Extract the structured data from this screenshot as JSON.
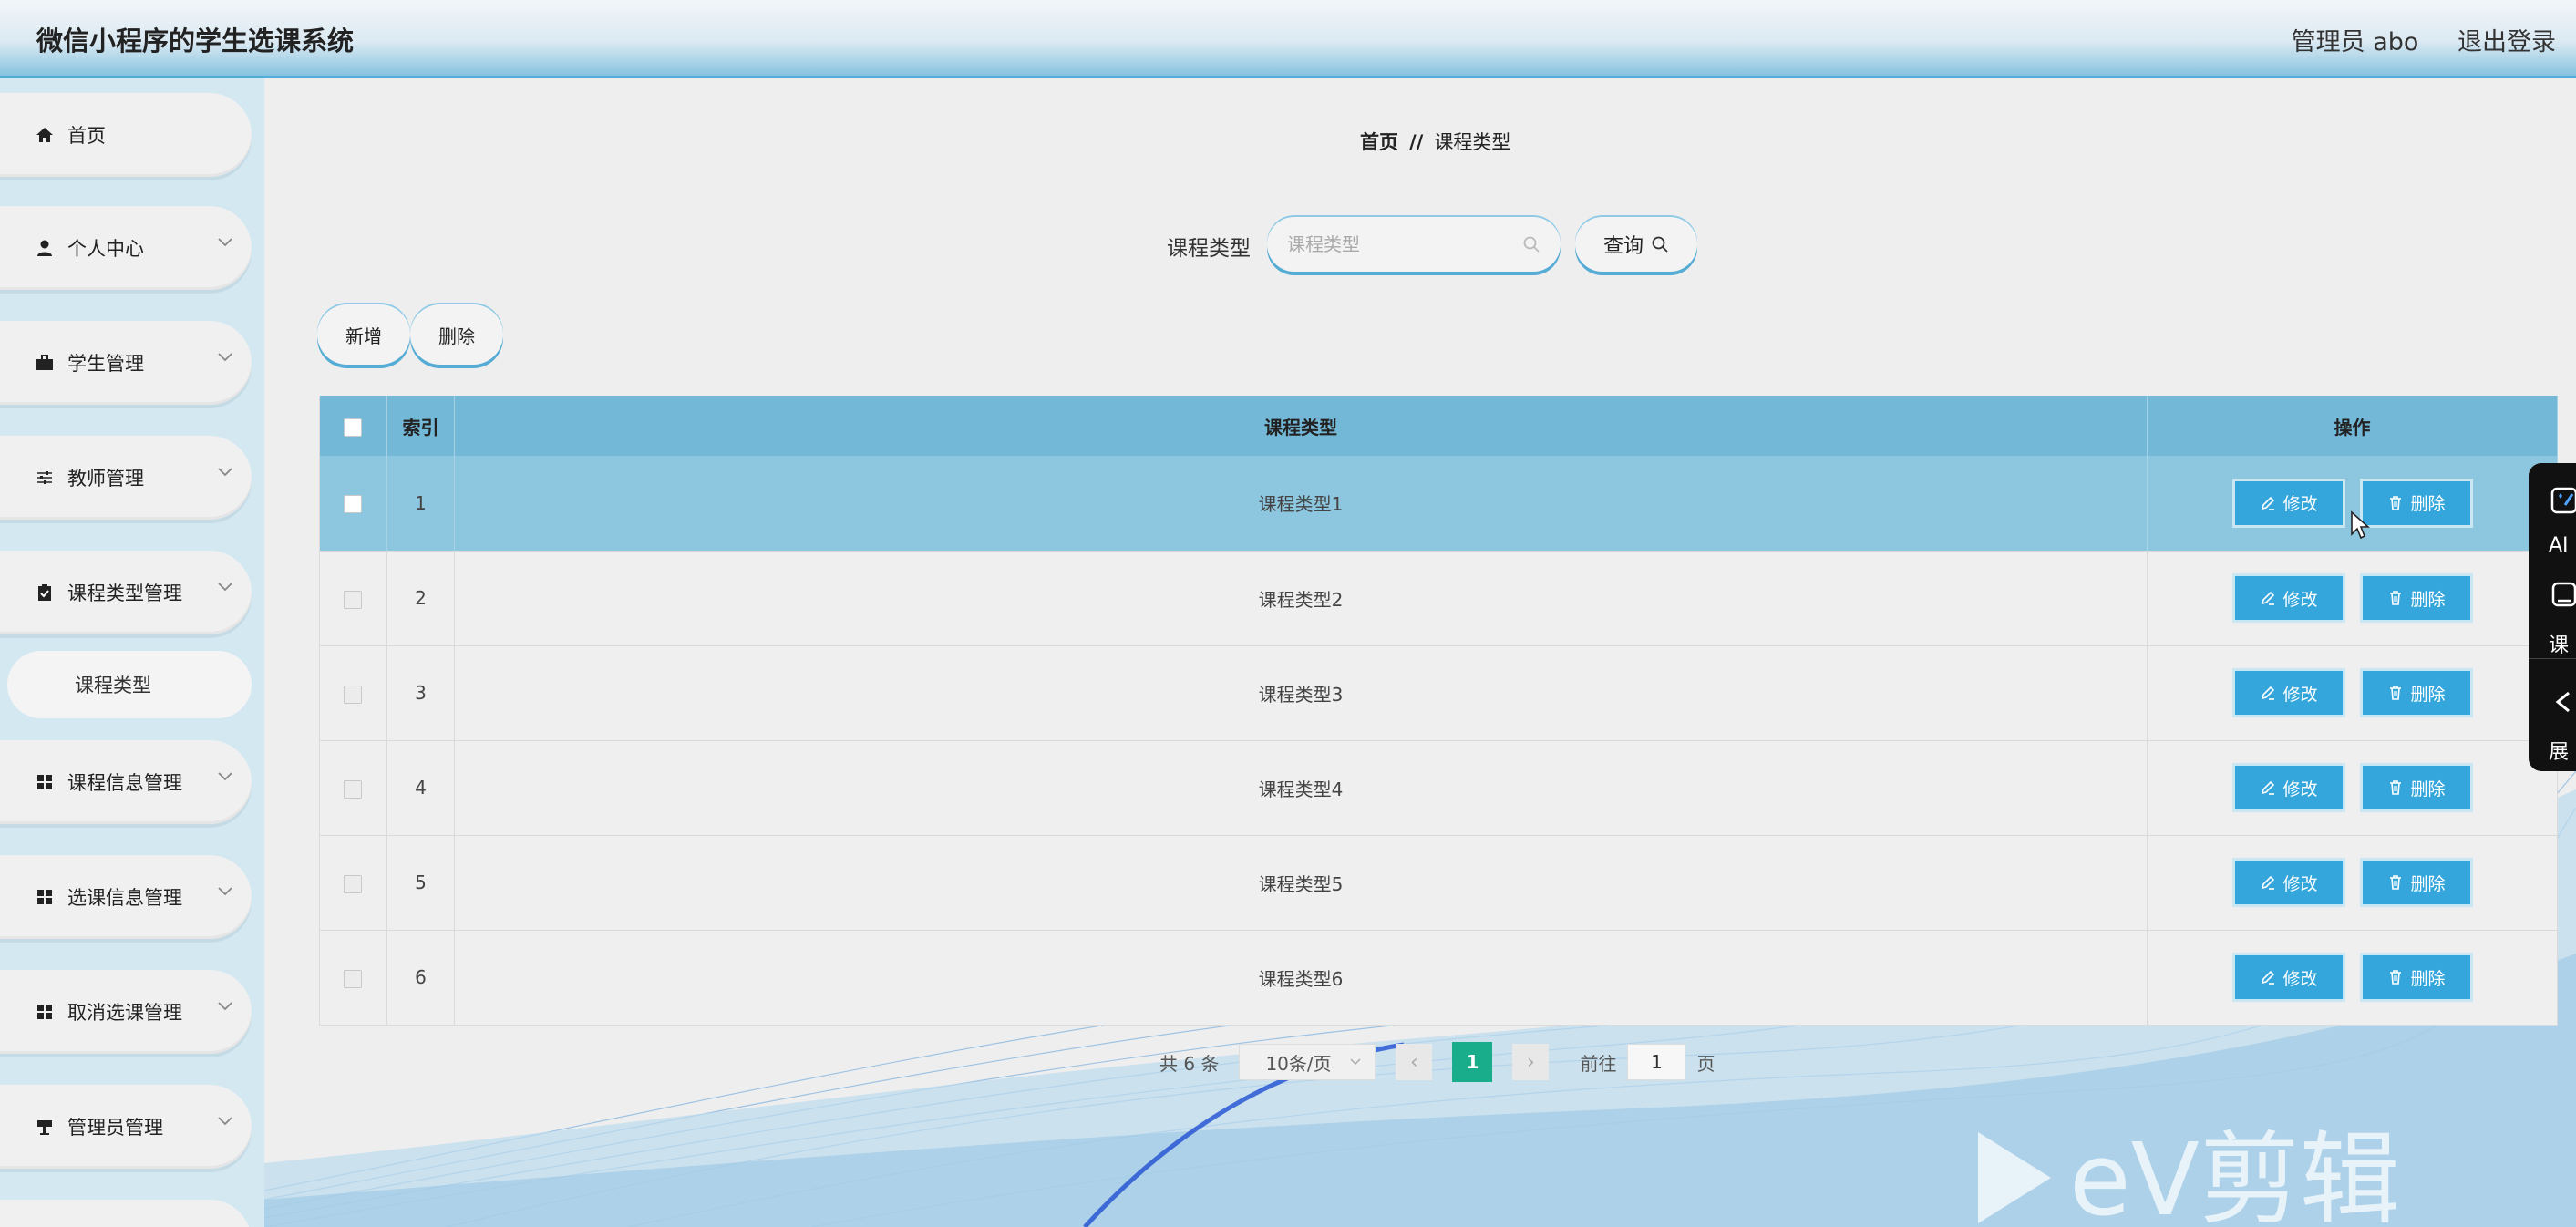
{
  "header": {
    "title": "微信小程序的学生选课系统",
    "user": "管理员 abo",
    "logout": "退出登录"
  },
  "sidebar": {
    "items": [
      {
        "label": "首页",
        "icon": "home-icon"
      },
      {
        "label": "个人中心",
        "icon": "user-icon"
      },
      {
        "label": "学生管理",
        "icon": "briefcase-icon"
      },
      {
        "label": "教师管理",
        "icon": "sliders-icon"
      },
      {
        "label": "课程类型管理",
        "icon": "clipboard-check-icon"
      },
      {
        "label": "课程信息管理",
        "icon": "grid-icon"
      },
      {
        "label": "选课信息管理",
        "icon": "grid-icon"
      },
      {
        "label": "取消选课管理",
        "icon": "grid-icon"
      },
      {
        "label": "管理员管理",
        "icon": "podium-icon"
      }
    ],
    "sub_item": "课程类型"
  },
  "breadcrumb": {
    "home": "首页",
    "separator": "//",
    "current": "课程类型"
  },
  "search": {
    "label": "课程类型",
    "placeholder": "课程类型",
    "button": "查询"
  },
  "toolbar": {
    "add": "新增",
    "delete": "删除"
  },
  "table": {
    "headers": {
      "index": "索引",
      "type": "课程类型",
      "actions": "操作"
    },
    "rows": [
      {
        "index": "1",
        "type": "课程类型1"
      },
      {
        "index": "2",
        "type": "课程类型2"
      },
      {
        "index": "3",
        "type": "课程类型3"
      },
      {
        "index": "4",
        "type": "课程类型4"
      },
      {
        "index": "5",
        "type": "课程类型5"
      },
      {
        "index": "6",
        "type": "课程类型6"
      }
    ],
    "edit_label": "修改",
    "delete_label": "删除"
  },
  "pagination": {
    "total": "共 6 条",
    "page_size": "10条/页",
    "current_page": "1",
    "goto_label": "前往",
    "goto_value": "1",
    "goto_unit": "页"
  },
  "float_panel": {
    "items": [
      {
        "label": "AI",
        "icon": "ai-icon"
      },
      {
        "label": "课",
        "icon": "tablet-icon"
      },
      {
        "label": "展",
        "icon": "chevron-left-icon"
      }
    ]
  },
  "watermark": "eV剪辑",
  "colors": {
    "accent": "#34a6dc",
    "table_header": "#74b8d8",
    "highlight_row": "#8dc6df",
    "pager_active": "#1aad8b"
  }
}
